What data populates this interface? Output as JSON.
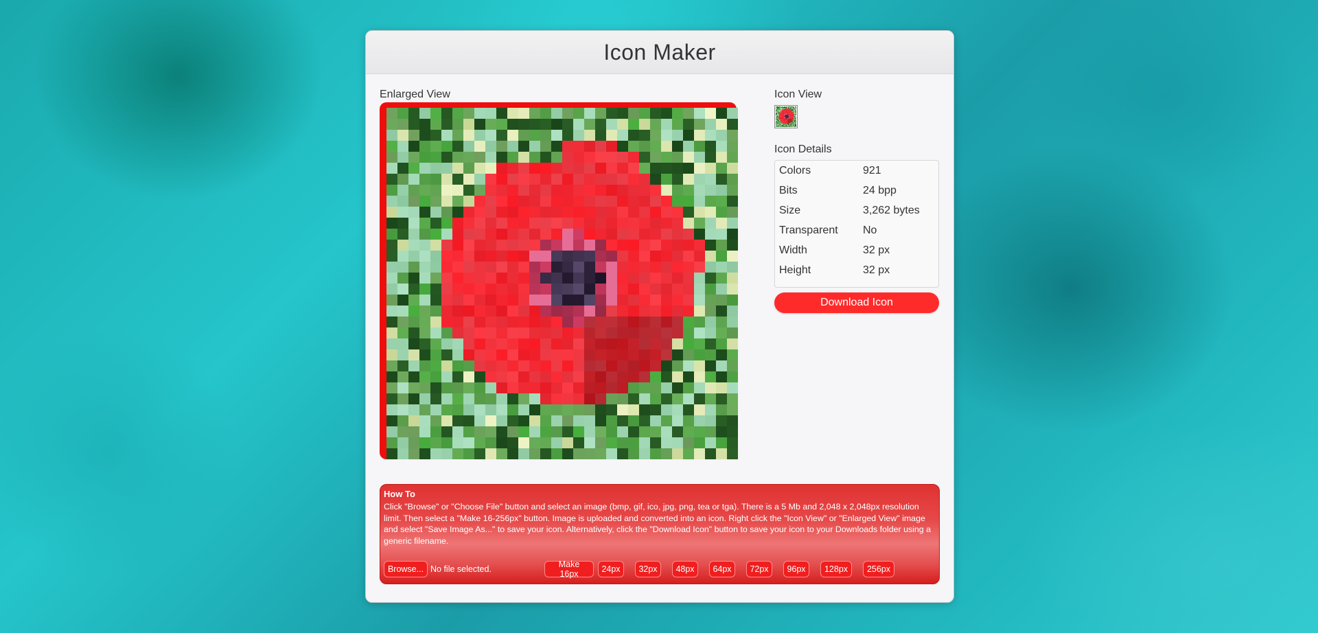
{
  "app": {
    "title": "Icon Maker"
  },
  "enlarged": {
    "label": "Enlarged View"
  },
  "icon_view": {
    "label": "Icon View"
  },
  "details": {
    "label": "Icon Details",
    "rows": [
      {
        "key": "Colors",
        "value": "921"
      },
      {
        "key": "Bits",
        "value": "24 bpp"
      },
      {
        "key": "Size",
        "value": "3,262 bytes"
      },
      {
        "key": "Transparent",
        "value": "No"
      },
      {
        "key": "Width",
        "value": "32 px"
      },
      {
        "key": "Height",
        "value": "32 px"
      }
    ]
  },
  "download": {
    "label": "Download Icon"
  },
  "howto": {
    "title": "How To",
    "text": "Click \"Browse\" or \"Choose File\" button and select an image (bmp, gif, ico, jpg, png, tea or tga). There is a 5 Mb and 2,048 x 2,048px resolution limit. Then select a \"Make 16-256px\" button. Image is uploaded and converted into an icon. Right click the \"Icon View\" or \"Enlarged View\" image and select \"Save Image As...\" to save your icon. Alternatively, click the \"Download Icon\" button to save your icon to your Downloads folder using a generic filename.",
    "browse_label": "Browse...",
    "file_status": "No file selected.",
    "size_buttons": [
      "Make 16px",
      "24px",
      "32px",
      "48px",
      "64px",
      "72px",
      "96px",
      "128px",
      "256px"
    ]
  },
  "colors": {
    "accent": "#ff2a2a",
    "frame": "#ee0e0e"
  }
}
